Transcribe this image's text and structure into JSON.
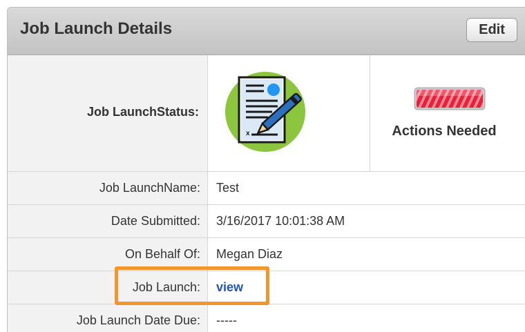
{
  "panel": {
    "title": "Job Launch Details",
    "edit_label": "Edit"
  },
  "status": {
    "label": "Job LaunchStatus:",
    "icon": "document-sign-icon",
    "indicator": "red-striped-status-bar",
    "actions_text": "Actions Needed"
  },
  "details": [
    {
      "label": "Job LaunchName:",
      "value": "Test"
    },
    {
      "label": "Date Submitted:",
      "value": "3/16/2017 10:01:38 AM"
    },
    {
      "label": "On Behalf Of:",
      "value": "Megan Diaz"
    },
    {
      "label": "Job Launch:",
      "value": "view"
    },
    {
      "label": "Job Launch Date Due:",
      "value": "-----"
    }
  ],
  "colors": {
    "link": "#2255b5",
    "highlight": "#f0962d",
    "icon_circle": "#8cc63f",
    "status_bar": "#e8213a"
  }
}
